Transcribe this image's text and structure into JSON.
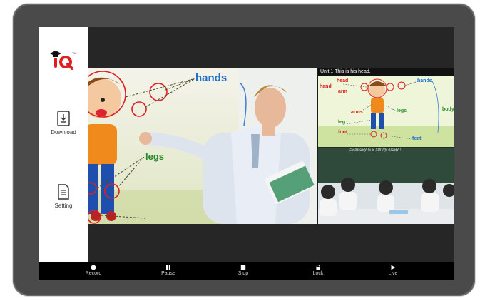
{
  "sidebar": {
    "logo_text": "iQ",
    "logo_tm": "TM",
    "download_label": "Download",
    "setting_label": "Setting"
  },
  "lesson": {
    "unit_title": "Unit 1  This  is  his  head.",
    "left_labels": {
      "hands": "hands",
      "legs": "legs"
    },
    "right_labels": {
      "head": "head",
      "hand": "hand",
      "arm": "arm",
      "hands": "hands",
      "arms": "arms",
      "legs": "legs",
      "body": "body",
      "leg": "leg",
      "foot": "foot",
      "feet": "feet"
    },
    "chalkboard_text": "Saturday  is  a  sunny  today !"
  },
  "controls": {
    "record": "Record",
    "pause": "Pause",
    "stop": "Stop",
    "lock": "Lock",
    "live": "Live"
  },
  "colors": {
    "bezel": "#4a4a4a",
    "screen": "#262626",
    "accent_red": "#e02020",
    "label_blue": "#1f6fd1",
    "label_green": "#2a8a2a"
  }
}
